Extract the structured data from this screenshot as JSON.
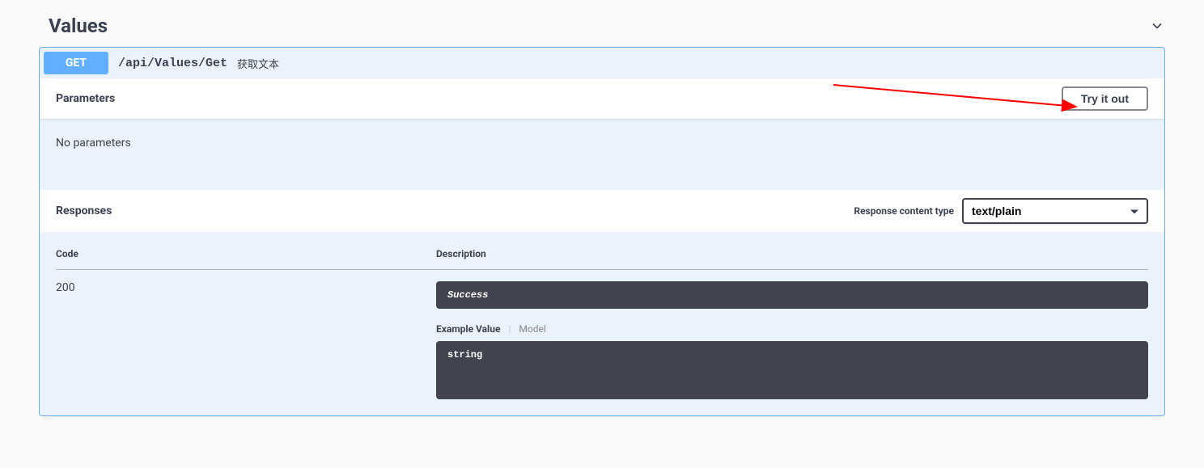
{
  "tag": {
    "title": "Values"
  },
  "operation": {
    "method": "GET",
    "path": "/api/Values/Get",
    "summary": "获取文本"
  },
  "parameters": {
    "heading": "Parameters",
    "try_label": "Try it out",
    "empty_message": "No parameters"
  },
  "responses": {
    "heading": "Responses",
    "content_type_label": "Response content type",
    "content_type_value": "text/plain",
    "columns": {
      "code": "Code",
      "description": "Description"
    },
    "rows": [
      {
        "code": "200",
        "description": "Success",
        "tabs": {
          "example": "Example Value",
          "model": "Model"
        },
        "example": "string"
      }
    ]
  }
}
